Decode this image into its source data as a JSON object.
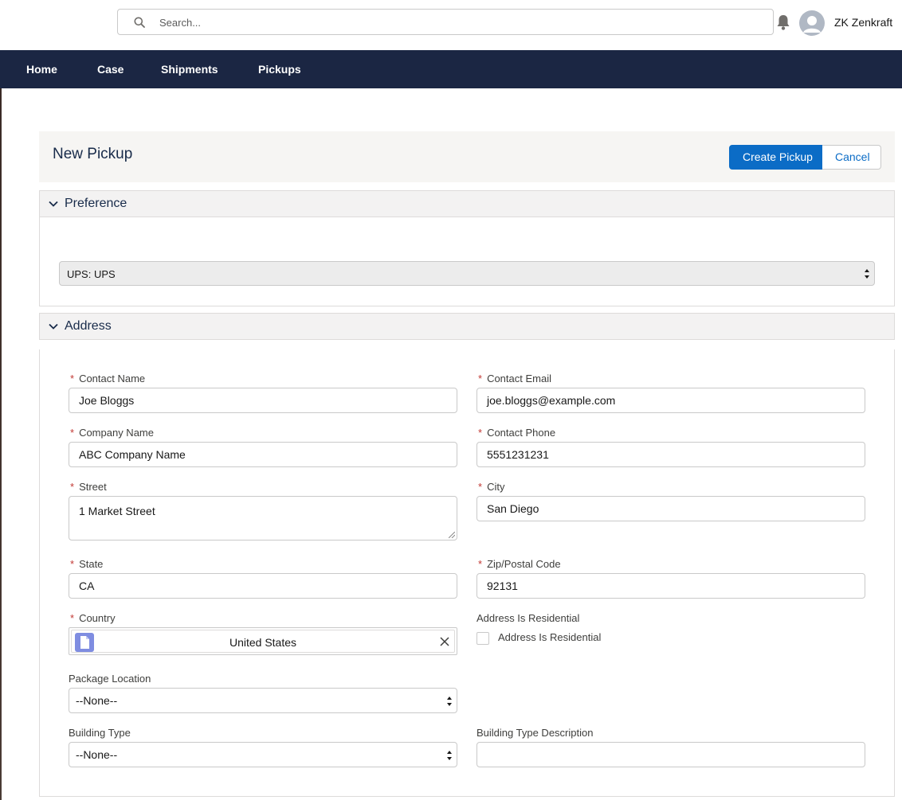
{
  "header": {
    "search_placeholder": "Search...",
    "user_name": "ZK Zenkraft"
  },
  "nav": {
    "items": [
      {
        "label": "Home"
      },
      {
        "label": "Case"
      },
      {
        "label": "Shipments"
      },
      {
        "label": "Pickups"
      }
    ]
  },
  "page": {
    "title": "New Pickup",
    "create_label": "Create Pickup",
    "cancel_label": "Cancel"
  },
  "preference": {
    "title": "Preference",
    "carrier_value": "UPS: UPS"
  },
  "address": {
    "title": "Address",
    "required_mark": "*",
    "contact_name": {
      "label": "Contact Name",
      "value": "Joe Bloggs"
    },
    "contact_email": {
      "label": "Contact Email",
      "value": "joe.bloggs@example.com"
    },
    "company_name": {
      "label": "Company Name",
      "value": "ABC Company Name"
    },
    "contact_phone": {
      "label": "Contact Phone",
      "value": "5551231231"
    },
    "street": {
      "label": "Street",
      "value": "1 Market Street"
    },
    "city": {
      "label": "City",
      "value": "San Diego"
    },
    "state": {
      "label": "State",
      "value": "CA"
    },
    "zip": {
      "label": "Zip/Postal Code",
      "value": "92131"
    },
    "country": {
      "label": "Country",
      "value": "United States"
    },
    "residential": {
      "label": "Address Is Residential",
      "checkbox_label": "Address Is Residential",
      "checked": false
    },
    "package_location": {
      "label": "Package Location",
      "value": "--None--"
    },
    "building_type": {
      "label": "Building Type",
      "value": "--None--"
    },
    "building_type_description": {
      "label": "Building Type Description",
      "value": ""
    }
  },
  "colors": {
    "nav_bg": "#1b2643",
    "brand": "#0b6cc6",
    "required": "#c23934"
  }
}
